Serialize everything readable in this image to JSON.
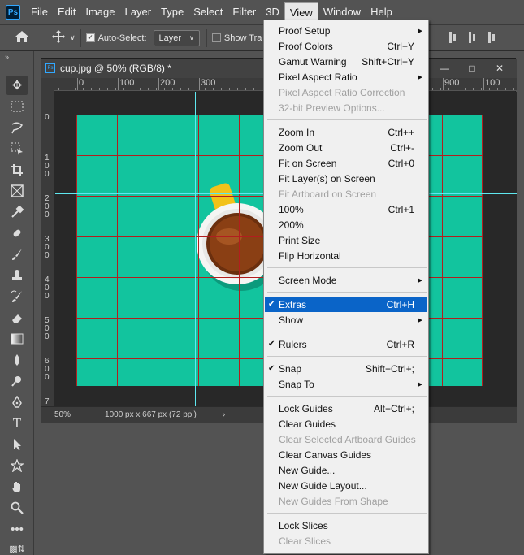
{
  "app": {
    "logo_text": "Ps"
  },
  "menubar": {
    "items": [
      "File",
      "Edit",
      "Image",
      "Layer",
      "Type",
      "Select",
      "Filter",
      "3D",
      "View",
      "Window",
      "Help"
    ],
    "active": "View"
  },
  "options": {
    "auto_select_label": "Auto-Select:",
    "layer_dropdown": "Layer",
    "show_transform_label": "Show Tra"
  },
  "document": {
    "title": "cup.jpg @ 50% (RGB/8) *",
    "zoom": "50%",
    "info": "1000 px x 667 px (72 ppi)",
    "ruler_top_labels": [
      "0",
      "100",
      "200",
      "300",
      "900",
      "100"
    ],
    "ruler_left_labels": [
      "0",
      "1 0 0",
      "2 0 0",
      "3 0 0",
      "4 0 0",
      "5 0 0",
      "6 0 0",
      "7"
    ],
    "colors": {
      "canvas": "#12c49e",
      "grid": "#b21e1e",
      "guide": "#5fe8f0",
      "cup_handle": "#f2c21a"
    }
  },
  "view_menu": {
    "items": [
      {
        "label": "Proof Setup",
        "shortcut": "",
        "submenu": true,
        "disabled": false,
        "checked": false
      },
      {
        "label": "Proof Colors",
        "shortcut": "Ctrl+Y"
      },
      {
        "label": "Gamut Warning",
        "shortcut": "Shift+Ctrl+Y"
      },
      {
        "label": "Pixel Aspect Ratio",
        "shortcut": "",
        "submenu": true
      },
      {
        "label": "Pixel Aspect Ratio Correction",
        "disabled": true
      },
      {
        "label": "32-bit Preview Options...",
        "disabled": true
      },
      {
        "label": "Zoom In",
        "shortcut": "Ctrl++"
      },
      {
        "label": "Zoom Out",
        "shortcut": "Ctrl+-"
      },
      {
        "label": "Fit on Screen",
        "shortcut": "Ctrl+0"
      },
      {
        "label": "Fit Layer(s) on Screen"
      },
      {
        "label": "Fit Artboard on Screen",
        "disabled": true
      },
      {
        "label": "100%",
        "shortcut": "Ctrl+1"
      },
      {
        "label": "200%"
      },
      {
        "label": "Print Size"
      },
      {
        "label": "Flip Horizontal"
      },
      {
        "label": "Screen Mode",
        "submenu": true
      },
      {
        "label": "Extras",
        "shortcut": "Ctrl+H",
        "checked": true,
        "highlighted": true
      },
      {
        "label": "Show",
        "submenu": true
      },
      {
        "label": "Rulers",
        "shortcut": "Ctrl+R",
        "checked": true
      },
      {
        "label": "Snap",
        "shortcut": "Shift+Ctrl+;",
        "checked": true
      },
      {
        "label": "Snap To",
        "submenu": true
      },
      {
        "label": "Lock Guides",
        "shortcut": "Alt+Ctrl+;"
      },
      {
        "label": "Clear Guides"
      },
      {
        "label": "Clear Selected Artboard Guides",
        "disabled": true
      },
      {
        "label": "Clear Canvas Guides"
      },
      {
        "label": "New Guide..."
      },
      {
        "label": "New Guide Layout..."
      },
      {
        "label": "New Guides From Shape",
        "disabled": true
      },
      {
        "label": "Lock Slices"
      },
      {
        "label": "Clear Slices",
        "disabled": true
      }
    ]
  }
}
